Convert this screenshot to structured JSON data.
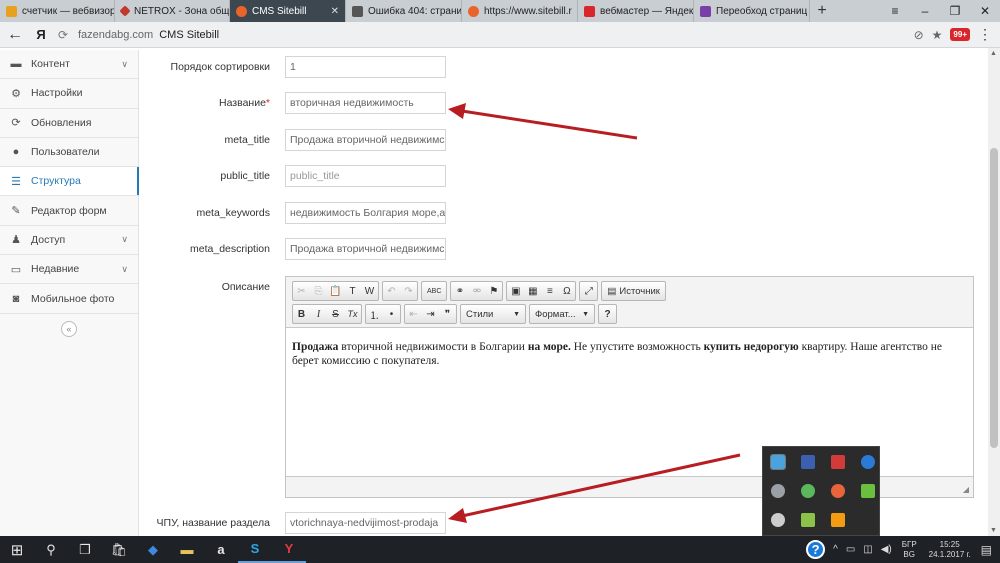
{
  "browser": {
    "tabs": [
      {
        "label": "счетчик — вебвизор",
        "favicon": "yandex-metrica-icon",
        "color": "#e8a020"
      },
      {
        "label": "NETROX - Зона общ",
        "favicon": "netrox-icon",
        "color": "#c0392b"
      },
      {
        "label": "CMS Sitebill",
        "favicon": "sitebill-icon",
        "color": "#e8642a",
        "active": true
      },
      {
        "label": "Ошибка 404: страни",
        "favicon": "house-icon",
        "color": "#555555"
      },
      {
        "label": "https://www.sitebill.r",
        "favicon": "sitebill-icon",
        "color": "#e8642a"
      },
      {
        "label": "вебмастер — Яндек",
        "favicon": "yandex-icon",
        "color": "#d9262b"
      },
      {
        "label": "Переобход страниц",
        "favicon": "webmaster-icon",
        "color": "#7a3ea8"
      }
    ],
    "new_tab": "+",
    "window_controls": [
      "≡",
      "–",
      "❐",
      "✕"
    ],
    "back": "←",
    "yandex": "Я",
    "reload": "⟳",
    "url_host": "fazendabg.com",
    "url_title": "CMS Sitebill",
    "addr_icons": [
      "⊘",
      "★"
    ],
    "badge": "99+",
    "menu": "⋮"
  },
  "sidebar": {
    "items": [
      {
        "label": "Контент",
        "icon": "content-icon",
        "glyph": "▬",
        "chevron": true
      },
      {
        "label": "Настройки",
        "icon": "gear-icon",
        "glyph": "⚙",
        "chevron": false
      },
      {
        "label": "Обновления",
        "icon": "refresh-icon",
        "glyph": "⟳",
        "chevron": false
      },
      {
        "label": "Пользователи",
        "icon": "user-icon",
        "glyph": "●",
        "chevron": false
      },
      {
        "label": "Структура",
        "icon": "list-icon",
        "glyph": "☰",
        "chevron": false,
        "active": true
      },
      {
        "label": "Редактор форм",
        "icon": "edit-icon",
        "glyph": "✎",
        "chevron": false
      },
      {
        "label": "Доступ",
        "icon": "users-icon",
        "glyph": "♟",
        "chevron": true
      },
      {
        "label": "Недавние",
        "icon": "monitor-icon",
        "glyph": "▭",
        "chevron": true
      },
      {
        "label": "Мобильное фото",
        "icon": "camera-icon",
        "glyph": "◙",
        "chevron": false
      }
    ],
    "collapse": "«"
  },
  "form": {
    "sort_order": {
      "label": "Порядок сортировки",
      "value": "1"
    },
    "name": {
      "label": "Название",
      "required": "*",
      "value": "вторичная недвижимость"
    },
    "meta_title": {
      "label": "meta_title",
      "value": "Продажа вторичной недвижимс"
    },
    "public_title": {
      "label": "public_title",
      "placeholder": "public_title"
    },
    "meta_keywords": {
      "label": "meta_keywords",
      "value": "недвижимость Болгария море,а"
    },
    "meta_description": {
      "label": "meta_description",
      "value": "Продажа вторичной недвижимс"
    },
    "description": {
      "label": "Описание"
    },
    "slug": {
      "label": "ЧПУ, название раздела",
      "value": "vtorichnaya-nedvijimost-prodaja"
    }
  },
  "editor": {
    "toolbar": {
      "cut": "✂",
      "copy": "⎘",
      "paste": "📋",
      "paste_text": "T",
      "paste_word": "W",
      "undo": "↶",
      "redo": "↷",
      "spellcheck": "ABC",
      "link": "⚭",
      "unlink": "⚮",
      "anchor": "⚑",
      "image": "▣",
      "table": "▦",
      "hr": "≡",
      "special_char": "Ω",
      "maximize": "⤢",
      "source": "Источник",
      "bold": "B",
      "italic": "I",
      "strike": "S",
      "remove_format": "Tx",
      "ol": "⒈",
      "ul": "•",
      "outdent": "⇤",
      "indent": "⇥",
      "blockquote": "❞",
      "styles": "Стили",
      "format": "Формат...",
      "help": "?"
    },
    "content": {
      "p1": "Продажа",
      "p2": " вторичной недвижимости в Болгарии ",
      "p3": "на море.",
      "p4": " Не упустите возможность ",
      "p5": "купить недорогую",
      "p6": "  квартиру.  Наше агентство не берет комиссию с покупателя."
    },
    "resize": "◢"
  },
  "tray_popup": {
    "icons": [
      {
        "name": "app-tray-1-icon",
        "color": "#4aa3df"
      },
      {
        "name": "app-tray-2-icon",
        "color": "#3c5fb0"
      },
      {
        "name": "app-tray-3-icon",
        "color": "#d33b3b"
      },
      {
        "name": "bluetooth-icon",
        "color": "#2b7bd6"
      },
      {
        "name": "cloud-icon",
        "color": "#9aa0a6"
      },
      {
        "name": "leaf-icon",
        "color": "#5cb85c"
      },
      {
        "name": "flower-icon",
        "color": "#e8643a"
      },
      {
        "name": "app-tray-8-icon",
        "color": "#6bbf3f"
      },
      {
        "name": "pen-icon",
        "color": "#cccccc"
      },
      {
        "name": "plant-icon",
        "color": "#8bc34a"
      },
      {
        "name": "app-tray-11-icon",
        "color": "#f39c12"
      }
    ]
  },
  "taskbar": {
    "start": "⊞",
    "search": "⚲",
    "task_view": "❐",
    "apps": [
      {
        "name": "store-icon",
        "glyph": "🛍"
      },
      {
        "name": "dropbox-icon",
        "glyph": "◆"
      },
      {
        "name": "folder-icon",
        "glyph": "▬"
      },
      {
        "name": "amazon-icon",
        "glyph": "a"
      },
      {
        "name": "skype-icon",
        "glyph": "S"
      },
      {
        "name": "yandex-browser-icon",
        "glyph": "Y"
      }
    ],
    "help": "?",
    "tray_chevron": "^",
    "tray_icons": [
      "▭",
      "◫",
      "◀)"
    ],
    "lang_line1": "БГР",
    "lang_line2": "BG",
    "time": "15:25",
    "date": "24.1.2017 г.",
    "notifications": "▤"
  },
  "colors": {
    "accent": "#2679b5",
    "arrow": "#b81d21"
  }
}
